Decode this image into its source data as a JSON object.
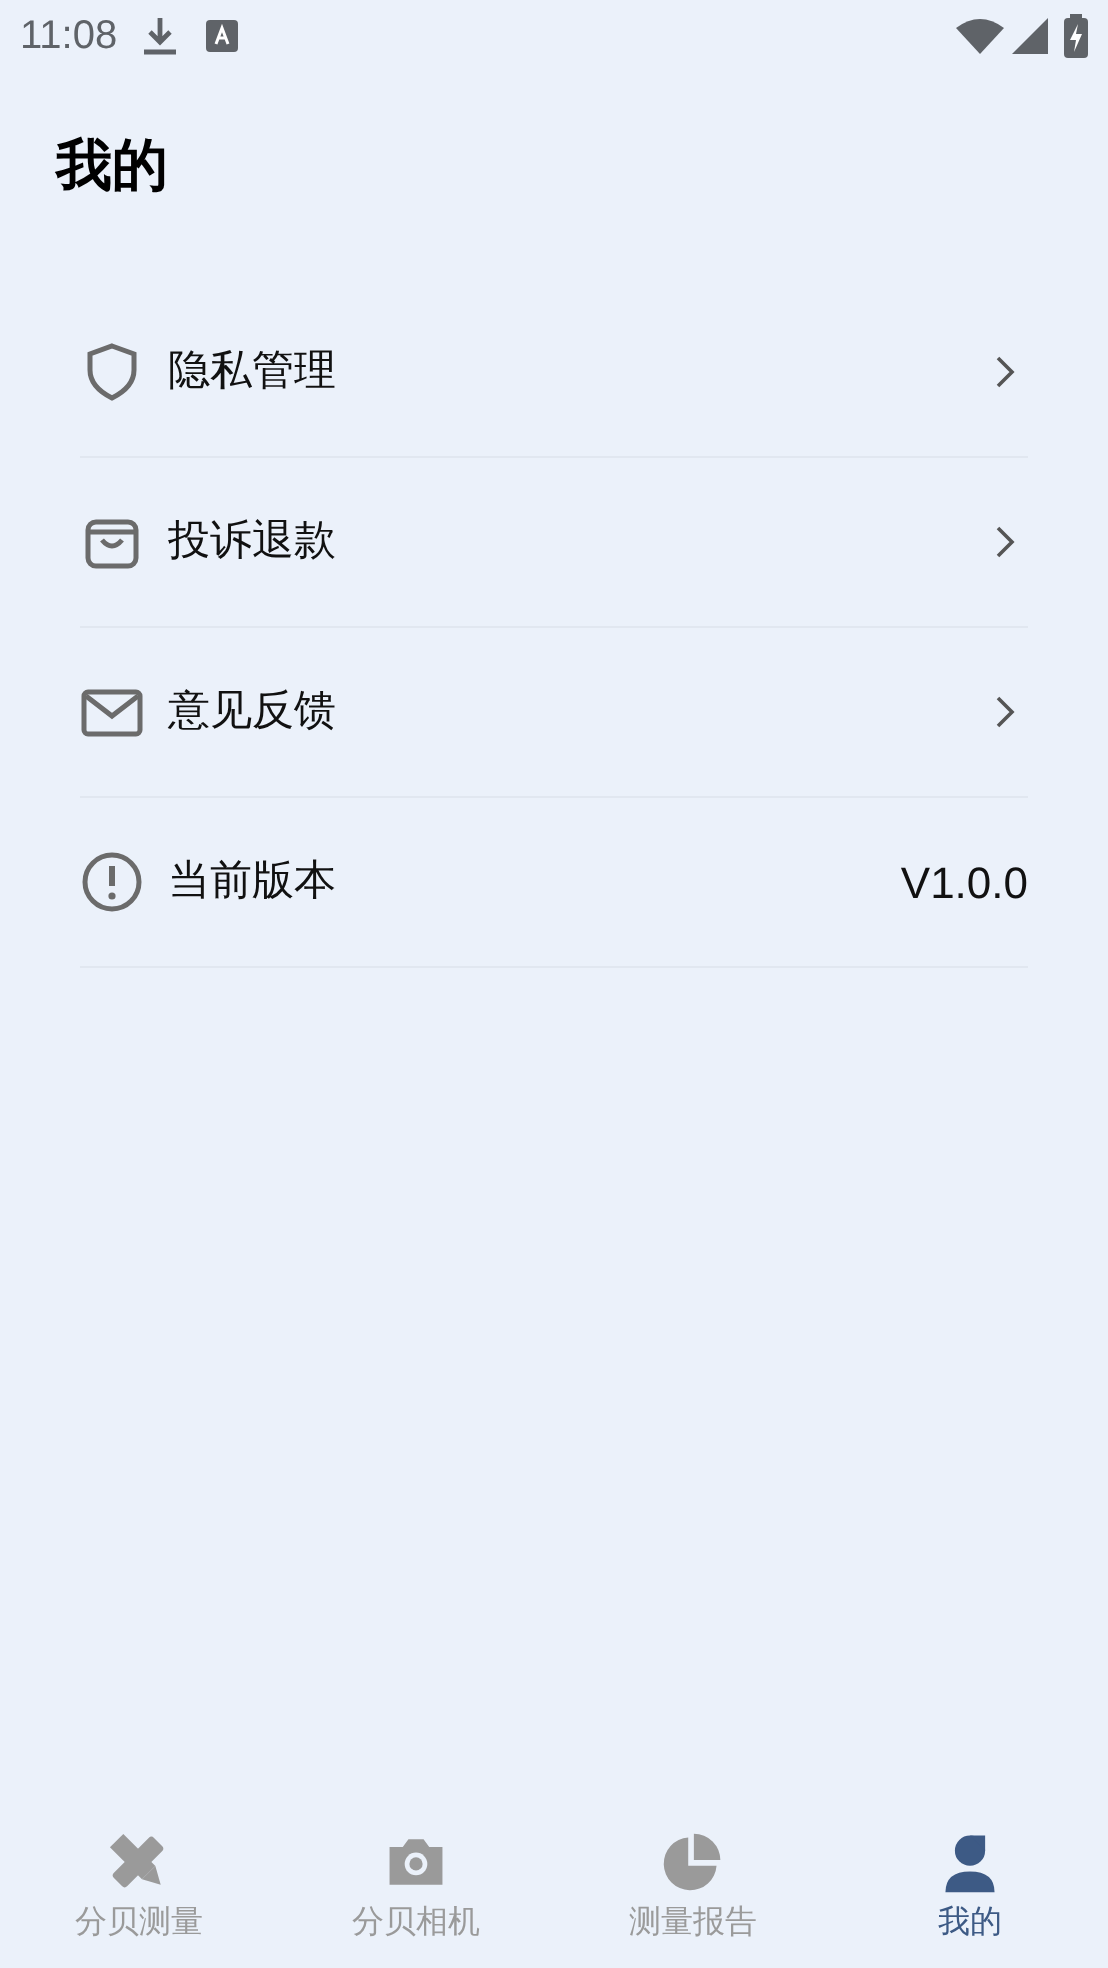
{
  "status_bar": {
    "time": "11:08"
  },
  "title": "我的",
  "menu": [
    {
      "kind": "link",
      "label": "隐私管理"
    },
    {
      "kind": "link",
      "label": "投诉退款"
    },
    {
      "kind": "link",
      "label": "意见反馈"
    },
    {
      "kind": "info",
      "label": "当前版本",
      "value": "V1.0.0"
    }
  ],
  "tabs": [
    {
      "label": "分贝测量",
      "selected": false
    },
    {
      "label": "分贝相机",
      "selected": false
    },
    {
      "label": "测量报告",
      "selected": false
    },
    {
      "label": "我的",
      "selected": true
    }
  ]
}
